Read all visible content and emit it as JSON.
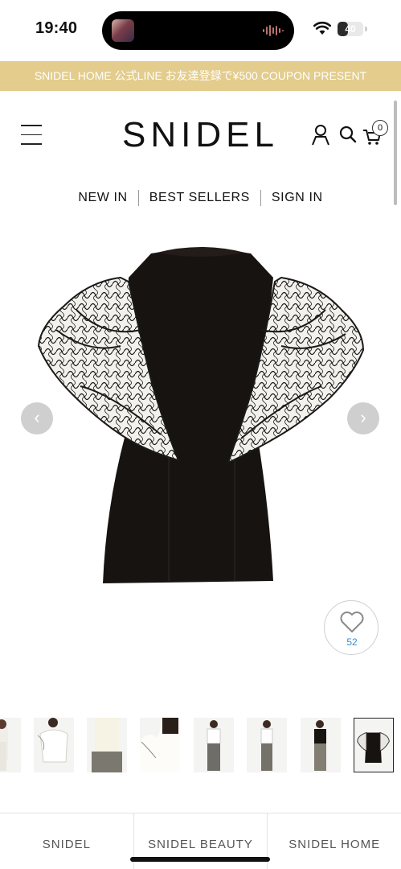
{
  "status_bar": {
    "time": "19:40",
    "battery_level": "40",
    "battery_fraction": 0.4,
    "icons": [
      "now-playing-thumbnail-icon",
      "audio-waveform-icon",
      "wifi-icon",
      "battery-icon"
    ]
  },
  "banner": {
    "text": "SNIDEL HOME  公式LINE  お友達登録で¥500 COUPON PRESENT",
    "color": "#e3cc8c"
  },
  "header": {
    "logo": "SNIDEL",
    "icons": [
      "hamburger-menu-icon",
      "user-icon",
      "search-icon",
      "cart-icon"
    ],
    "cart_count": "0"
  },
  "nav": {
    "new_in": "NEW IN",
    "best_sellers": "BEST SELLERS",
    "sign_in": "SIGN IN"
  },
  "gallery": {
    "prev_icon": "‹",
    "next_icon": "›",
    "favorite_count": "52",
    "thumbnail_count": 8,
    "active_thumbnail": 8
  },
  "tabs": {
    "snidel": "SNIDEL",
    "snidel_beauty": "SNIDEL BEAUTY",
    "snidel_home": "SNIDEL HOME"
  },
  "colors": {
    "accent_banner": "#e3cc8c",
    "favorite_count": "#3a8bd1",
    "product_body": "#171311"
  }
}
